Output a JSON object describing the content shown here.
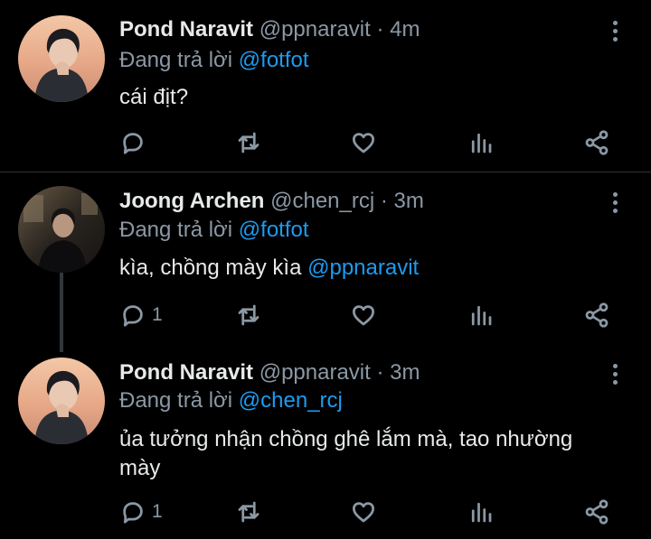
{
  "tweets": [
    {
      "name": "Pond Naravit",
      "handle": "@ppnaravit",
      "sep": "·",
      "time": "4m",
      "reply_prefix": "Đang trả lời",
      "reply_to": "@fotfot",
      "text": "cái địt?",
      "text_mention": "",
      "reply_count": "",
      "avatar": "pond-avatar"
    },
    {
      "name": "Joong Archen",
      "handle": "@chen_rcj",
      "sep": "·",
      "time": "3m",
      "reply_prefix": "Đang trả lời",
      "reply_to": "@fotfot",
      "text": "kìa, chồng mày kìa ",
      "text_mention": "@ppnaravit",
      "reply_count": "1",
      "avatar": "joong-avatar"
    },
    {
      "name": "Pond Naravit",
      "handle": "@ppnaravit",
      "sep": "·",
      "time": "3m",
      "reply_prefix": "Đang trả lời",
      "reply_to": "@chen_rcj",
      "text": "ủa tưởng nhận chồng ghê lắm mà, tao nhường mày",
      "text_mention": "",
      "reply_count": "1",
      "avatar": "pond-avatar"
    }
  ],
  "icons": {
    "reply": "reply-icon",
    "retweet": "retweet-icon",
    "like": "heart-icon",
    "views": "views-icon",
    "share": "share-icon",
    "more": "more-vertical-icon"
  },
  "colors": {
    "background": "#000000",
    "text": "#e7e9ea",
    "muted": "#8b98a5",
    "accent": "#1d9bf0",
    "divider": "#2f3336"
  }
}
